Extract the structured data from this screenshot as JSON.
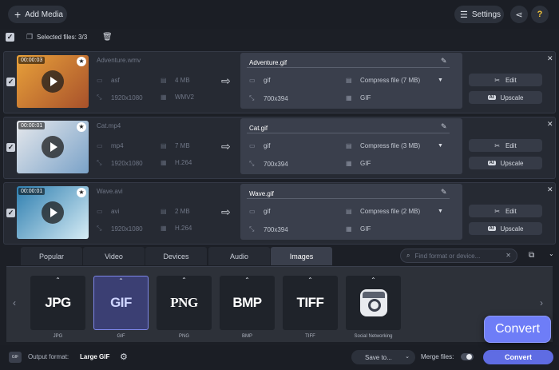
{
  "toolbar": {
    "add_media_label": "Add Media",
    "settings_label": "Settings"
  },
  "selection": {
    "label": "Selected files: 3/3"
  },
  "files": [
    {
      "duration": "00:00:03",
      "name": "Adventure.wmv",
      "format": "asf",
      "size": "4 MB",
      "resolution": "1920x1080",
      "codec": "WMV2",
      "output_name": "Adventure.gif",
      "output_format": "gif",
      "compress_label": "Compress file (7 MB)",
      "output_resolution": "700x394",
      "output_codec": "GIF",
      "edit_label": "Edit",
      "upscale_label": "Upscale",
      "thumb_colors": [
        "#e8a13a",
        "#a8512b"
      ]
    },
    {
      "duration": "00:00:01",
      "name": "Cat.mp4",
      "format": "mp4",
      "size": "7 MB",
      "resolution": "1920x1080",
      "codec": "H.264",
      "output_name": "Cat.gif",
      "output_format": "gif",
      "compress_label": "Compress file (3 MB)",
      "output_resolution": "700x394",
      "output_codec": "GIF",
      "edit_label": "Edit",
      "upscale_label": "Upscale",
      "thumb_colors": [
        "#e6e8ec",
        "#7aa2c8"
      ]
    },
    {
      "duration": "00:00:01",
      "name": "Wave.avi",
      "format": "avi",
      "size": "2 MB",
      "resolution": "1920x1080",
      "codec": "H.264",
      "output_name": "Wave.gif",
      "output_format": "gif",
      "compress_label": "Compress file (2 MB)",
      "output_resolution": "700x394",
      "output_codec": "GIF",
      "edit_label": "Edit",
      "upscale_label": "Upscale",
      "thumb_colors": [
        "#2f7fb0",
        "#d6ecf5"
      ]
    }
  ],
  "tabs": [
    {
      "label": "Popular",
      "active": false
    },
    {
      "label": "Video",
      "active": false
    },
    {
      "label": "Devices",
      "active": false
    },
    {
      "label": "Audio",
      "active": false
    },
    {
      "label": "Images",
      "active": true
    }
  ],
  "search": {
    "placeholder": "Find format or device..."
  },
  "formats": [
    {
      "logo": "JPG",
      "label": "JPG",
      "active": false
    },
    {
      "logo": "GIF",
      "label": "GIF",
      "active": true
    },
    {
      "logo": "PNG",
      "label": "PNG",
      "active": false
    },
    {
      "logo": "BMP",
      "label": "BMP",
      "active": false
    },
    {
      "logo": "TIFF",
      "label": "TIFF",
      "active": false
    },
    {
      "logo": "",
      "label": "Social Networking",
      "active": false
    }
  ],
  "bottom": {
    "output_format_label": "Output format:",
    "output_format_value": "Large GIF",
    "save_to_label": "Save to...",
    "merge_label": "Merge files:",
    "convert_label": "Convert"
  },
  "tooltip": {
    "label": "Convert"
  },
  "colors": {
    "accent": "#5f6ce3",
    "active_format_bg": "#3b3f73",
    "help_icon": "#f0c239"
  }
}
